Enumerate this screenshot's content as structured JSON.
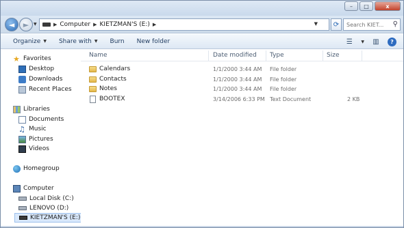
{
  "window": {
    "controls": [
      "–",
      "□",
      "x"
    ]
  },
  "nav": {
    "back_glyph": "◄",
    "forward_glyph": "►"
  },
  "address": {
    "crumbs": [
      "Computer",
      "KIETZMAN'S (E:)"
    ],
    "separator": "▶",
    "search_placeholder": "Search KIET..."
  },
  "toolbar": {
    "organize": "Organize",
    "share_with": "Share with",
    "burn": "Burn",
    "new_folder": "New folder"
  },
  "sidebar": {
    "favorites": "Favorites",
    "favorites_items": [
      "Desktop",
      "Downloads",
      "Recent Places"
    ],
    "libraries": "Libraries",
    "libraries_items": [
      "Documents",
      "Music",
      "Pictures",
      "Videos"
    ],
    "homegroup": "Homegroup",
    "computer": "Computer",
    "computer_items": [
      "Local Disk (C:)",
      "LENOVO (D:)",
      "KIETZMAN'S (E:)"
    ]
  },
  "columns": {
    "name": "Name",
    "date_modified": "Date modified",
    "type": "Type",
    "size": "Size"
  },
  "files": [
    {
      "name": "Calendars",
      "date": "1/1/2000 3:44 AM",
      "type": "File folder",
      "size": "",
      "icon": "folder-icon"
    },
    {
      "name": "Contacts",
      "date": "1/1/2000 3:44 AM",
      "type": "File folder",
      "size": "",
      "icon": "folder-icon"
    },
    {
      "name": "Notes",
      "date": "1/1/2000 3:44 AM",
      "type": "File folder",
      "size": "",
      "icon": "folder-icon"
    },
    {
      "name": "BOOTEX",
      "date": "3/14/2006 6:33 PM",
      "type": "Text Document",
      "size": "2 KB",
      "icon": "text-file-icon"
    }
  ]
}
